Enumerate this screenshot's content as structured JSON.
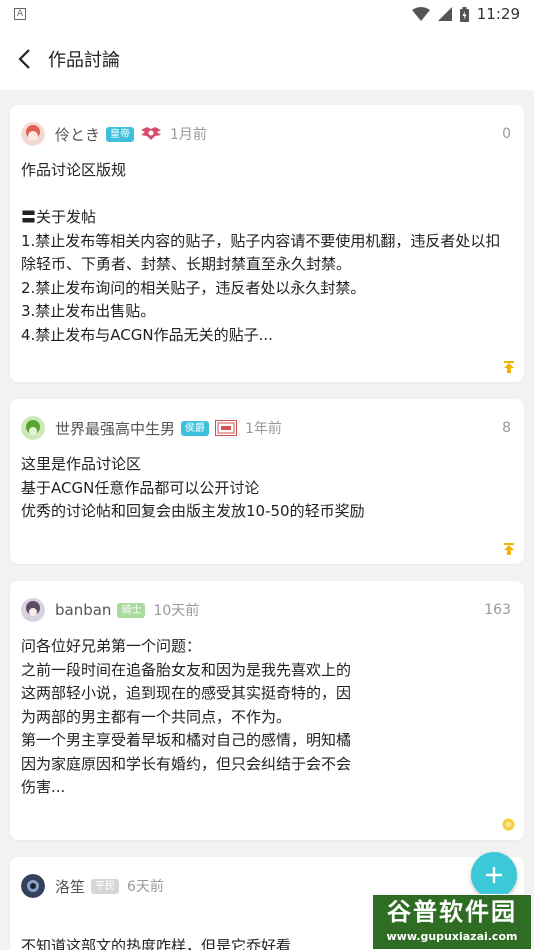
{
  "status_bar": {
    "time": "11:29",
    "left_icon": "A"
  },
  "header": {
    "title": "作品討論"
  },
  "posts": [
    {
      "username": "伶とき",
      "rank": "皇帝",
      "rank_color": "#3ec0dc",
      "time": "1月前",
      "count": "0",
      "content": "作品讨论区版规\n\n〓关于发帖\n1.禁止发布等相关内容的贴子，贴子内容请不要使用机翻，违反者处以扣除轻币、下勇者、封禁、长期封禁直至永久封禁。\n2.禁止发布询问的相关贴子，违反者处以永久封禁。\n3.禁止发布出售贴。\n4.禁止发布与ACGN作品无关的贴子..."
    },
    {
      "username": "世界最强高中生男",
      "rank": "侯爵",
      "rank_color": "#3ec0dc",
      "time": "1年前",
      "count": "8",
      "content": "这里是作品讨论区\n基于ACGN任意作品都可以公开讨论\n优秀的讨论帖和回复会由版主发放10-50的轻币奖励"
    },
    {
      "username": "banban",
      "rank": "骑士",
      "rank_color": "#a8dc9c",
      "time": "10天前",
      "count": "163",
      "content": "问各位好兄弟第一个问题：\n之前一段时间在追备胎女友和因为是我先喜欢上的\n这两部轻小说，追到现在的感受其实挺奇特的，因\n为两部的男主都有一个共同点，不作为。\n第一个男主享受着早坂和橘对自己的感情，明知橘\n因为家庭原因和学长有婚约，但只会纠结于会不会\n伤害..."
    },
    {
      "username": "洛笙",
      "rank": "平民",
      "rank_color": "#d6d6d6",
      "time": "6天前",
      "count": "",
      "content": "\n不知道这部文的热度咋样，但是它乔好看"
    }
  ],
  "fab": {
    "icon": "plus-icon"
  },
  "watermark": {
    "main": "谷普软件园",
    "sub": "www.gupuxiazai.com"
  }
}
